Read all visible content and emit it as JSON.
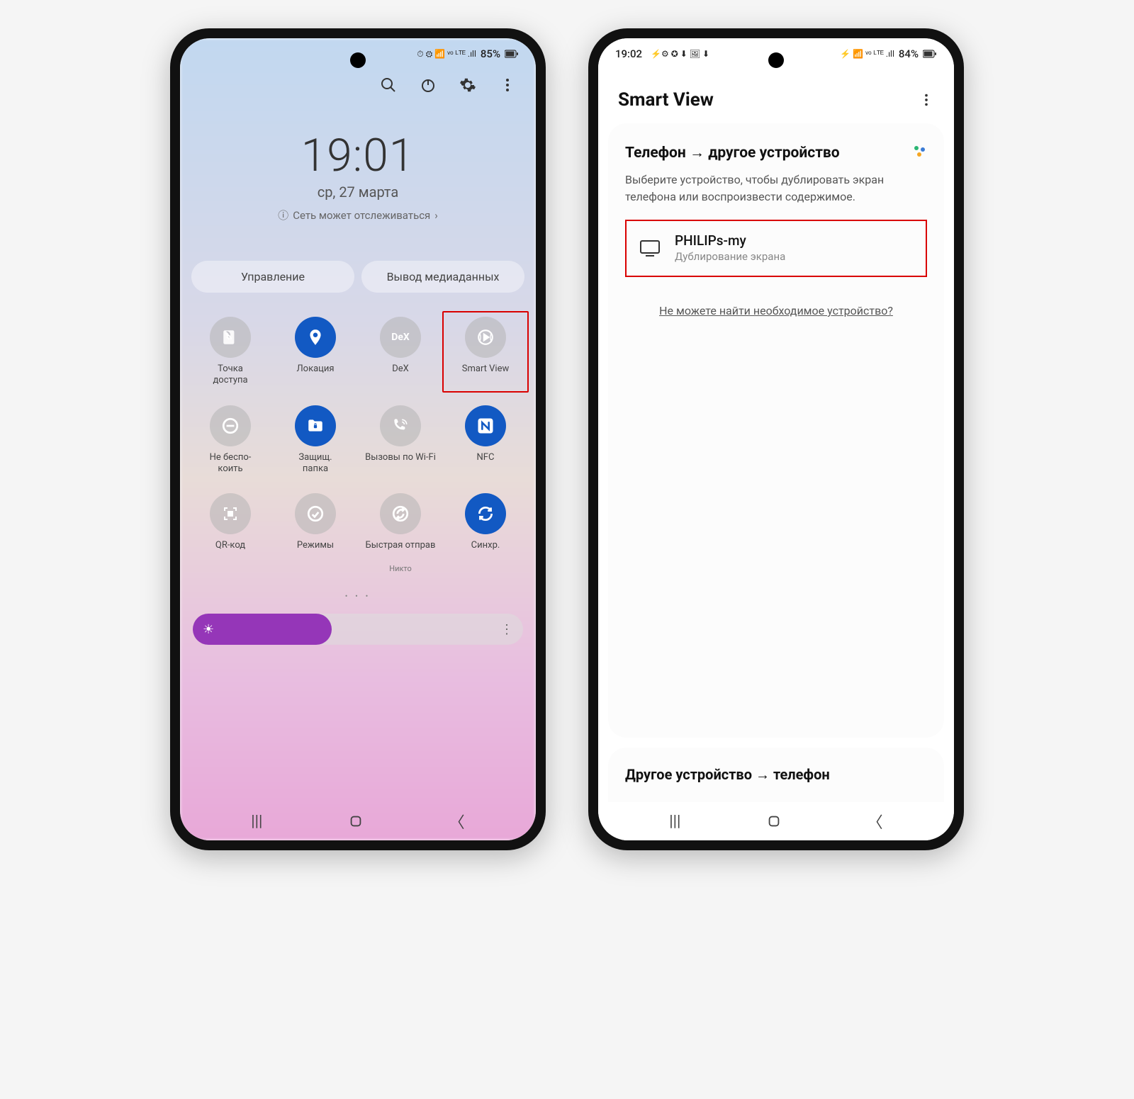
{
  "phone1": {
    "status": {
      "battery": "85%",
      "icons": "⏱ ⚙ ᯤ ⟟ LTE ₁₁₁"
    },
    "top_icons": {
      "search": "search",
      "power": "power",
      "settings": "settings",
      "more": "more"
    },
    "time": "19:01",
    "date": "ср, 27 марта",
    "network_note": "Сеть может отслеживаться",
    "tabs": {
      "manage": "Управление",
      "media": "Вывод медиаданных"
    },
    "tiles": [
      {
        "id": "hotspot",
        "label": "Точка\nдоступа",
        "state": "off",
        "glyph": "hotspot-icon"
      },
      {
        "id": "location",
        "label": "Локация",
        "state": "on",
        "glyph": "location-icon"
      },
      {
        "id": "dex",
        "label": "DeX",
        "state": "off",
        "glyph": "dex-icon"
      },
      {
        "id": "smartview",
        "label": "Smart View",
        "state": "off",
        "glyph": "smartview-icon",
        "highlight": true
      },
      {
        "id": "dnd",
        "label": "Не беспо-\nкоить",
        "state": "off",
        "glyph": "dnd-icon"
      },
      {
        "id": "secure",
        "label": "Защищ.\nпапка",
        "state": "on",
        "glyph": "folder-icon"
      },
      {
        "id": "wificall",
        "label": "Вызовы по Wi-Fi",
        "state": "off",
        "glyph": "wificall-icon"
      },
      {
        "id": "nfc",
        "label": "NFC",
        "state": "on",
        "glyph": "nfc-icon"
      },
      {
        "id": "qr",
        "label": "QR-код",
        "state": "off",
        "glyph": "qr-icon"
      },
      {
        "id": "modes",
        "label": "Режимы",
        "state": "off",
        "glyph": "modes-icon"
      },
      {
        "id": "quickshare",
        "label": "Быстрая отправ",
        "sub": "Никто",
        "state": "off",
        "glyph": "share-icon"
      },
      {
        "id": "sync",
        "label": "Синхр.",
        "state": "on",
        "glyph": "sync-icon"
      }
    ]
  },
  "phone2": {
    "status": {
      "time": "19:02",
      "battery": "84%",
      "left_icons": "⚡⚙✪⬇🖼⬇",
      "right_icons": "⚡ ᯤ LTE ₁₁₁"
    },
    "title": "Smart View",
    "section_heading": "Телефон → другое устройство",
    "description": "Выберите устройство, чтобы дублировать экран телефона или воспроизвести содержимое.",
    "device": {
      "name": "PHILIPs-my",
      "sub": "Дублирование экрана"
    },
    "help_link": "Не можете найти необходимое устройство?",
    "bottom_heading": "Другое устройство → телефон"
  }
}
